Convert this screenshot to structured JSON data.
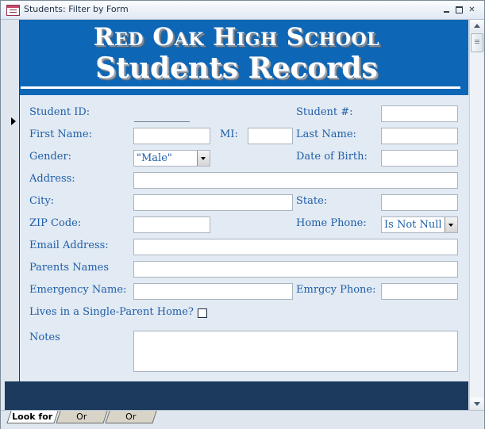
{
  "window": {
    "title": "Students: Filter by Form"
  },
  "header": {
    "school": "Red Oak High School",
    "subtitle": "Students Records"
  },
  "labels": {
    "student_id": "Student ID:",
    "student_num": "Student #:",
    "first_name": "First Name:",
    "mi": "MI:",
    "last_name": "Last Name:",
    "gender": "Gender:",
    "dob": "Date of Birth:",
    "address": "Address:",
    "city": "City:",
    "state": "State:",
    "zip": "ZIP Code:",
    "home_phone": "Home Phone:",
    "email": "Email Address:",
    "parents": "Parents Names",
    "emergency_name": "Emergency Name:",
    "emergency_phone": "Emrgcy Phone:",
    "single_parent": "Lives in a Single-Parent Home?",
    "notes": "Notes"
  },
  "values": {
    "gender": "\"Male\"",
    "home_phone": "Is Not Null"
  },
  "tabs": [
    "Look for",
    "Or",
    "Or"
  ],
  "icons": [
    "form-icon",
    "minimize-icon",
    "restore-icon",
    "close-icon",
    "record-selector-arrow-icon",
    "scroll-up-icon",
    "scroll-down-icon"
  ]
}
